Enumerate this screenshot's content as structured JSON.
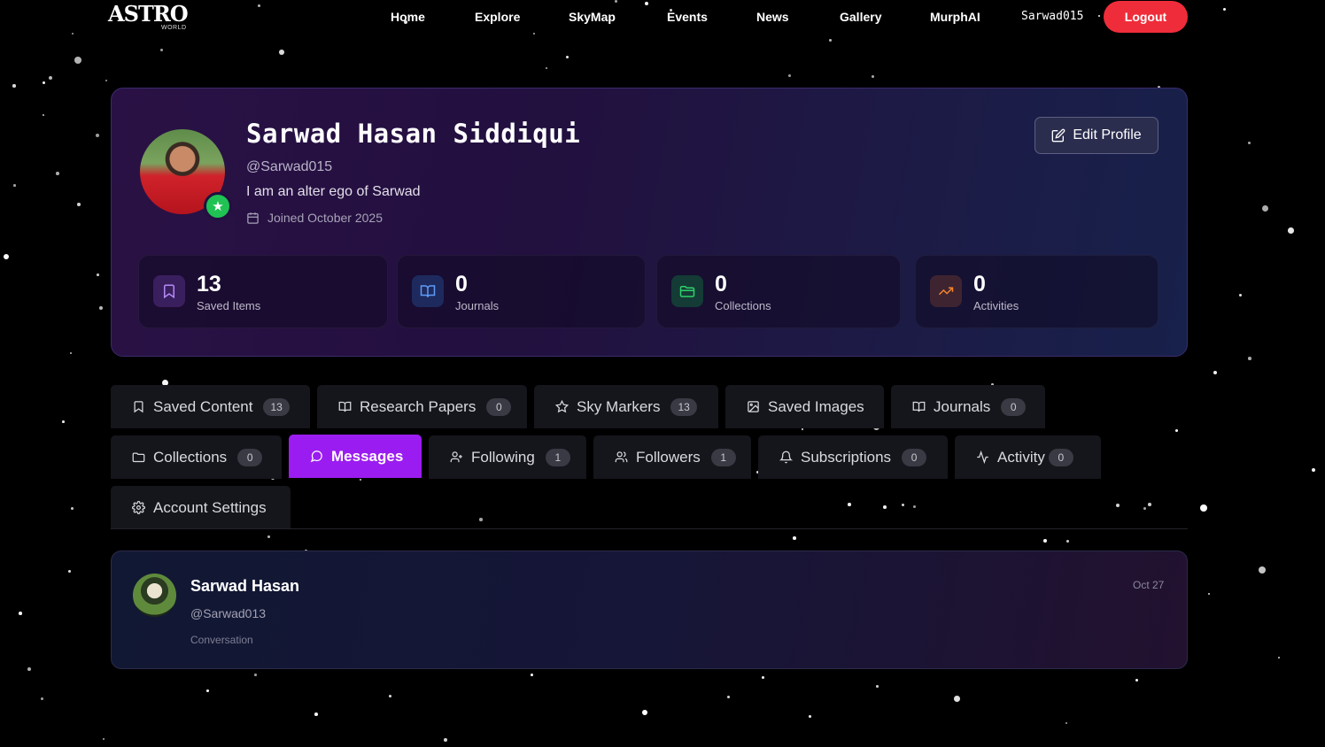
{
  "nav": {
    "logo_main": "ASTRO",
    "logo_sub": "WORLD",
    "links": [
      "Home",
      "Explore",
      "SkyMap",
      "Events",
      "News",
      "Gallery",
      "MurphAI"
    ],
    "username": "Sarwad015",
    "logout_label": "Logout"
  },
  "profile": {
    "name": "Sarwad Hasan Siddiqui",
    "handle": "@Sarwad015",
    "bio": "I am an alter ego of Sarwad",
    "joined": "Joined October 2025",
    "edit_label": "Edit Profile",
    "stats": [
      {
        "value": "13",
        "label": "Saved Items",
        "icon": "bookmark-icon",
        "color": "#9b6bf0"
      },
      {
        "value": "0",
        "label": "Journals",
        "icon": "book-open-icon",
        "color": "#4f8df7"
      },
      {
        "value": "0",
        "label": "Collections",
        "icon": "folder-icon",
        "color": "#22c55e"
      },
      {
        "value": "0",
        "label": "Activities",
        "icon": "trending-up-icon",
        "color": "#f97316"
      }
    ]
  },
  "tabs": [
    {
      "label": "Saved Content",
      "count": "13",
      "icon": "bookmark-icon"
    },
    {
      "label": "Research Papers",
      "count": "0",
      "icon": "book-icon"
    },
    {
      "label": "Sky Markers",
      "count": "13",
      "icon": "star-icon"
    },
    {
      "label": "Saved Images",
      "icon": "image-icon"
    },
    {
      "label": "Journals",
      "count": "0",
      "icon": "book-open-icon"
    },
    {
      "label": "Collections",
      "count": "0",
      "icon": "folder-icon"
    },
    {
      "label": "Messages",
      "icon": "message-icon"
    },
    {
      "label": "Following",
      "count": "1",
      "icon": "user-plus-icon"
    },
    {
      "label": "Followers",
      "count": "1",
      "icon": "users-icon"
    },
    {
      "label": "Subscriptions",
      "count": "0",
      "icon": "bell-icon"
    },
    {
      "label": "Activity",
      "count": "0",
      "icon": "activity-icon"
    },
    {
      "label": "Account Settings",
      "icon": "gear-icon"
    }
  ],
  "active_tab": "Messages",
  "conversation": {
    "name": "Sarwad Hasan",
    "handle": "@Sarwad013",
    "type": "Conversation",
    "date": "Oct 27"
  },
  "colors": {
    "accent": "#9b1cf0",
    "logout": "#ef2d3a",
    "badge": "#20c253"
  }
}
